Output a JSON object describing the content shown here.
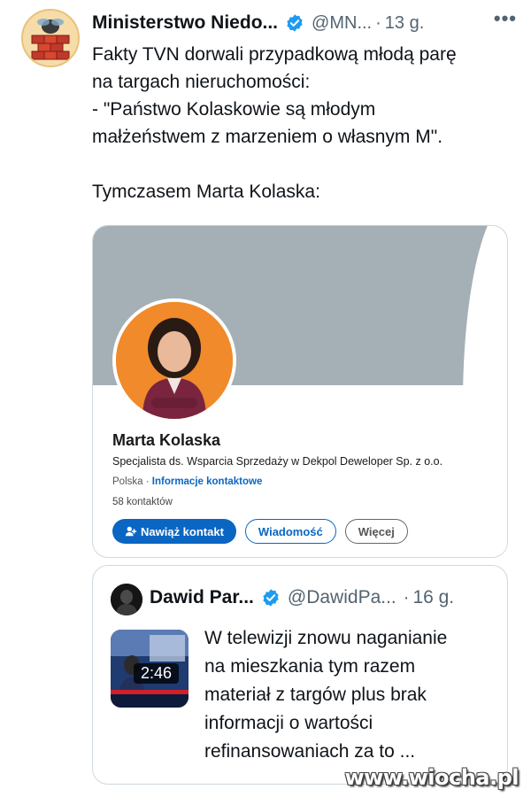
{
  "tweet": {
    "author_name": "Ministerstwo Niedo...",
    "handle": "@MN...",
    "separator": "·",
    "time": "13 g.",
    "more": "•••",
    "lines": [
      "Fakty TVN dorwali przypadkową młodą parę",
      "na targach nieruchomości:",
      "- \"Państwo Kolaskowie są młodym",
      "małżeństwem z marzeniem o własnym M\"."
    ],
    "line_after_gap": "Tymczasem Marta Kolaska:"
  },
  "linkedin_card": {
    "name": "Marta Kolaska",
    "title": "Specjalista ds. Wsparcia Sprzedaży w Dekpol Deweloper Sp. z o.o.",
    "location": "Polska",
    "location_sep": " · ",
    "contact_link": "Informacje kontaktowe",
    "connections": "58 kontaktów",
    "buttons": {
      "connect": "Nawiąż kontakt",
      "message": "Wiadomość",
      "more": "Więcej"
    },
    "colors": {
      "banner": "#a4b0b5",
      "brand_blue": "#0a66c2",
      "photo_bg": "#f08a2a"
    }
  },
  "quoted_tweet": {
    "author_name": "Dawid Par...",
    "handle": "@DawidPa...",
    "separator": "·",
    "time": "16 g.",
    "video_duration": "2:46",
    "lines": [
      "W telewizji znowu naganianie",
      "na mieszkania tym razem",
      "materiał z targów plus brak",
      "informacji o wartości",
      "refinansowaniach za to ..."
    ]
  },
  "watermark": "www.wiocha.pl",
  "colors": {
    "verified": "#1d9bf0",
    "secondary_text": "#536471"
  }
}
